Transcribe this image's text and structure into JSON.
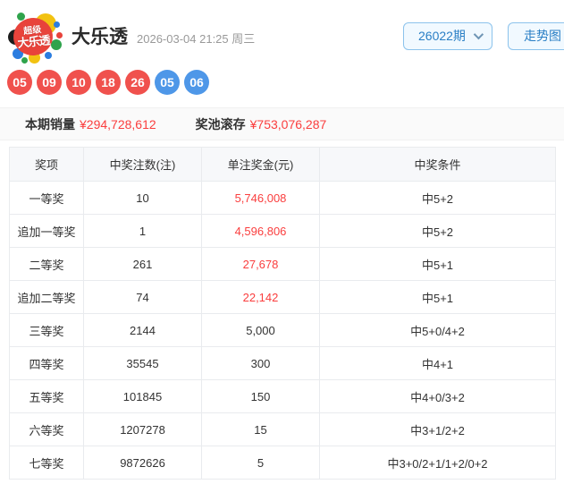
{
  "header": {
    "logo": {
      "line1": "超级",
      "line2": "大乐透"
    },
    "title": "大乐透",
    "datetime": "2026-03-04 21:25 周三",
    "issue_select_value": "26022期",
    "trend_button_label": "走势图"
  },
  "balls": {
    "front": [
      "05",
      "09",
      "10",
      "18",
      "26"
    ],
    "back": [
      "05",
      "06"
    ],
    "front_color": "#f0514d",
    "back_color": "#4e97e8"
  },
  "sales": {
    "sales_label": "本期销量",
    "sales_value": "¥294,728,612",
    "pool_label": "奖池滚存",
    "pool_value": "¥753,076,287"
  },
  "table": {
    "headers": [
      "奖项",
      "中奖注数(注)",
      "单注奖金(元)",
      "中奖条件"
    ],
    "rows": [
      {
        "prize": "一等奖",
        "count": "10",
        "amount": "5,746,008",
        "condition": "中5+2",
        "highlight": true
      },
      {
        "prize": "追加一等奖",
        "count": "1",
        "amount": "4,596,806",
        "condition": "中5+2",
        "highlight": true
      },
      {
        "prize": "二等奖",
        "count": "261",
        "amount": "27,678",
        "condition": "中5+1",
        "highlight": true
      },
      {
        "prize": "追加二等奖",
        "count": "74",
        "amount": "22,142",
        "condition": "中5+1",
        "highlight": true
      },
      {
        "prize": "三等奖",
        "count": "2144",
        "amount": "5,000",
        "condition": "中5+0/4+2",
        "highlight": false
      },
      {
        "prize": "四等奖",
        "count": "35545",
        "amount": "300",
        "condition": "中4+1",
        "highlight": false
      },
      {
        "prize": "五等奖",
        "count": "101845",
        "amount": "150",
        "condition": "中4+0/3+2",
        "highlight": false
      },
      {
        "prize": "六等奖",
        "count": "1207278",
        "amount": "15",
        "condition": "中3+1/2+2",
        "highlight": false
      },
      {
        "prize": "七等奖",
        "count": "9872626",
        "amount": "5",
        "condition": "中3+0/2+1/1+2/0+2",
        "highlight": false
      }
    ]
  },
  "colors": {
    "accent_red": "#fa3e3e",
    "control_blue": "#2a7fc5",
    "control_border": "#8cc3ec",
    "table_border": "#e9ebee",
    "header_bg": "#f7f8fa"
  }
}
